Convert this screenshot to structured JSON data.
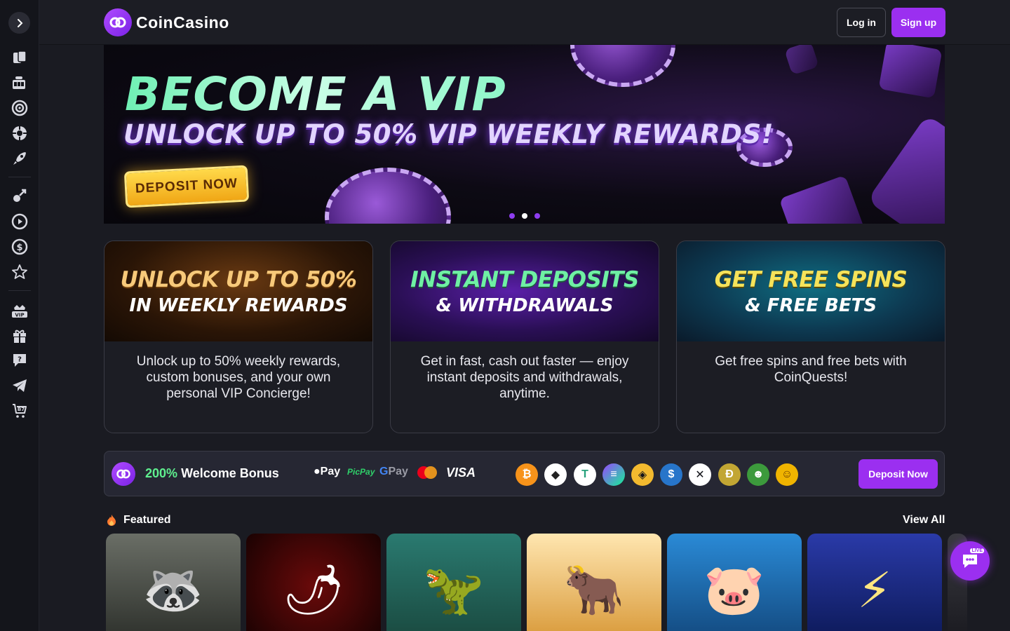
{
  "app": {
    "name": "CoinCasino",
    "brand_color": "#9b2ff0",
    "accent_green": "#5ff08f"
  },
  "sidebar": {
    "toggle_icon": "chevron-right-icon",
    "items": [
      {
        "name": "cards-icon"
      },
      {
        "name": "slots-icon"
      },
      {
        "name": "roulette-icon"
      },
      {
        "name": "dice-icon"
      },
      {
        "name": "rocket-icon"
      },
      {
        "name": "sports-icon"
      },
      {
        "name": "play-circle-icon"
      },
      {
        "name": "coin-icon"
      },
      {
        "name": "star-icon"
      },
      {
        "name": "vip-crown-icon"
      },
      {
        "name": "gift-icon"
      },
      {
        "name": "chat-support-icon"
      },
      {
        "name": "telegram-icon"
      },
      {
        "name": "cart-icon"
      }
    ]
  },
  "header": {
    "logo_text": "CoinCasino",
    "login_label": "Log in",
    "signup_label": "Sign up"
  },
  "hero": {
    "title": "BECOME A VIP",
    "subtitle": "UNLOCK UP TO 50% VIP WEEKLY REWARDS!",
    "cta_label": "DEPOSIT NOW",
    "slides": 3,
    "active_slide": 2
  },
  "cards": [
    {
      "heading_line1": "UNLOCK UP TO 50%",
      "heading_line2": "IN WEEKLY REWARDS",
      "body": "Unlock up to 50% weekly rewards, custom bonuses, and your own personal VIP Concierge!"
    },
    {
      "heading_line1": "INSTANT DEPOSITS",
      "heading_line2": "& WITHDRAWALS",
      "body": "Get in fast, cash out faster — enjoy instant deposits and withdrawals, anytime."
    },
    {
      "heading_line1": "GET FREE SPINS",
      "heading_line2": "& FREE BETS",
      "body": "Get free spins and free bets with CoinQuests!"
    }
  ],
  "bonus_bar": {
    "percent": "200%",
    "label": "Welcome Bonus",
    "payments": {
      "apple_pay": "Pay",
      "picpay": "PicPay",
      "gpay": "Pay",
      "visa": "VISA"
    },
    "cryptos": [
      {
        "name": "bitcoin-icon",
        "glyph": "₿",
        "color": "#f7931a"
      },
      {
        "name": "ethereum-icon",
        "glyph": "◆",
        "color": "#ffffff"
      },
      {
        "name": "tether-icon",
        "glyph": "T",
        "color": "#ffffff"
      },
      {
        "name": "solana-icon",
        "glyph": "≡",
        "color": "#ffffff"
      },
      {
        "name": "bnb-icon",
        "glyph": "◈",
        "color": "#f3ba2f"
      },
      {
        "name": "usdc-icon",
        "glyph": "$",
        "color": "#2775ca"
      },
      {
        "name": "xrp-icon",
        "glyph": "✕",
        "color": "#ffffff"
      },
      {
        "name": "dogecoin-icon",
        "glyph": "Ð",
        "color": "#c2a633"
      },
      {
        "name": "pepe-icon",
        "glyph": "☻",
        "color": "#3c9a3c"
      },
      {
        "name": "shiba-icon",
        "glyph": "☺",
        "color": "#f0b400"
      }
    ],
    "deposit_label": "Deposit Now"
  },
  "featured": {
    "title": "Featured",
    "view_all_label": "View All",
    "games": [
      {
        "name": "game-leprechaun",
        "glyph": "🦝",
        "bg": "#3a3f3a"
      },
      {
        "name": "game-chili",
        "glyph": "🌶",
        "bg": "#3a0606"
      },
      {
        "name": "game-dinosaur",
        "glyph": "🦖",
        "bg": "#1f5f5a"
      },
      {
        "name": "game-buffalo",
        "glyph": "🐂",
        "bg": "#c98a2a"
      },
      {
        "name": "game-pigs",
        "glyph": "🐷",
        "bg": "#1b6fb0"
      },
      {
        "name": "game-zeus",
        "glyph": "⚡",
        "bg": "#1d2f8a"
      }
    ]
  }
}
